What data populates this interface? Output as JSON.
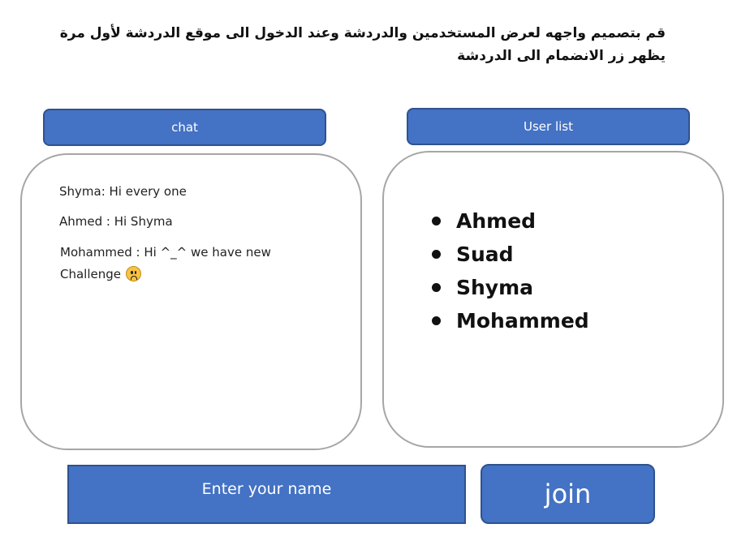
{
  "instruction": {
    "line1": "قم بتصميم واجهه لعرض المستخدمين والدردشة وعند الدخول الى موقع الدردشة لأول مرة",
    "line2": "يظهر زر الانضمام الى الدردشة"
  },
  "chat": {
    "header_label": "chat",
    "messages": [
      "Shyma: Hi every one",
      "Ahmed : Hi Shyma",
      "Mohammed : Hi ^_^ we have new",
      "Challenge"
    ],
    "emoji_icon": "sad-face-icon"
  },
  "user_list": {
    "header_label": "User list",
    "users": [
      "Ahmed",
      "Suad",
      "Shyma",
      "Mohammed"
    ]
  },
  "name_input": {
    "placeholder": "Enter your name"
  },
  "join_button": {
    "label": "join"
  },
  "colors": {
    "accent": "#4472c4",
    "accent_border": "#2f528f",
    "panel_border": "#a6a6a6"
  }
}
